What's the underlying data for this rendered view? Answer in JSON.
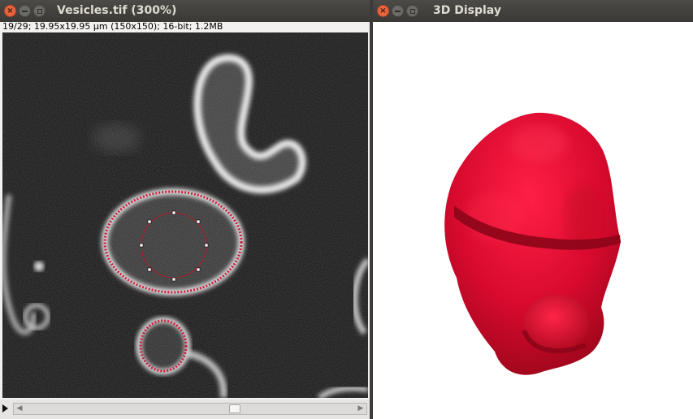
{
  "image_window": {
    "title": "Vesicles.tif (300%)",
    "info": "19/29; 19.95x19.95 µm (150x150); 16-bit; 1.2MB",
    "slice": {
      "current": 19,
      "total": 29
    }
  },
  "display_window": {
    "title": "3D Display"
  },
  "window_controls": {
    "close": "×"
  },
  "colors": {
    "surface": "#d0102e",
    "roi": "#c81e3c",
    "titlebar": "#3c3b37"
  }
}
